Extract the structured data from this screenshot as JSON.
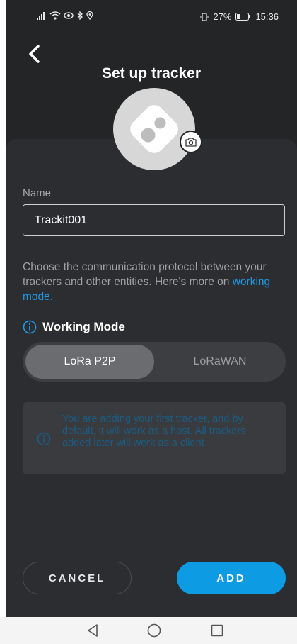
{
  "status_bar": {
    "battery_text": "27%",
    "time": "15:36"
  },
  "header": {
    "title": "Set up tracker"
  },
  "form": {
    "name_label": "Name",
    "name_value": "Trackit001",
    "description": "Choose the communication protocol between your trackers and other entities. Here's more on ",
    "description_link": "working mode.",
    "mode_title": "Working Mode",
    "modes": [
      {
        "label": "LoRa P2P",
        "selected": true
      },
      {
        "label": "LoRaWAN",
        "selected": false
      }
    ],
    "info_text": "You are adding your first tracker, and by default, it will work as a host. All trackers added later will work as a client."
  },
  "actions": {
    "cancel_label": "CANCEL",
    "add_label": "ADD"
  },
  "icons": {
    "back": "chevron-left-icon",
    "camera": "camera-icon",
    "info": "info-circle-icon",
    "nav_back": "triangle-back-icon",
    "nav_home": "circle-home-icon",
    "nav_recents": "square-recents-icon"
  },
  "colors": {
    "accent": "#0d9ce4",
    "link": "#1e9be8",
    "background": "#242527",
    "sheet": "#2c2d30"
  }
}
